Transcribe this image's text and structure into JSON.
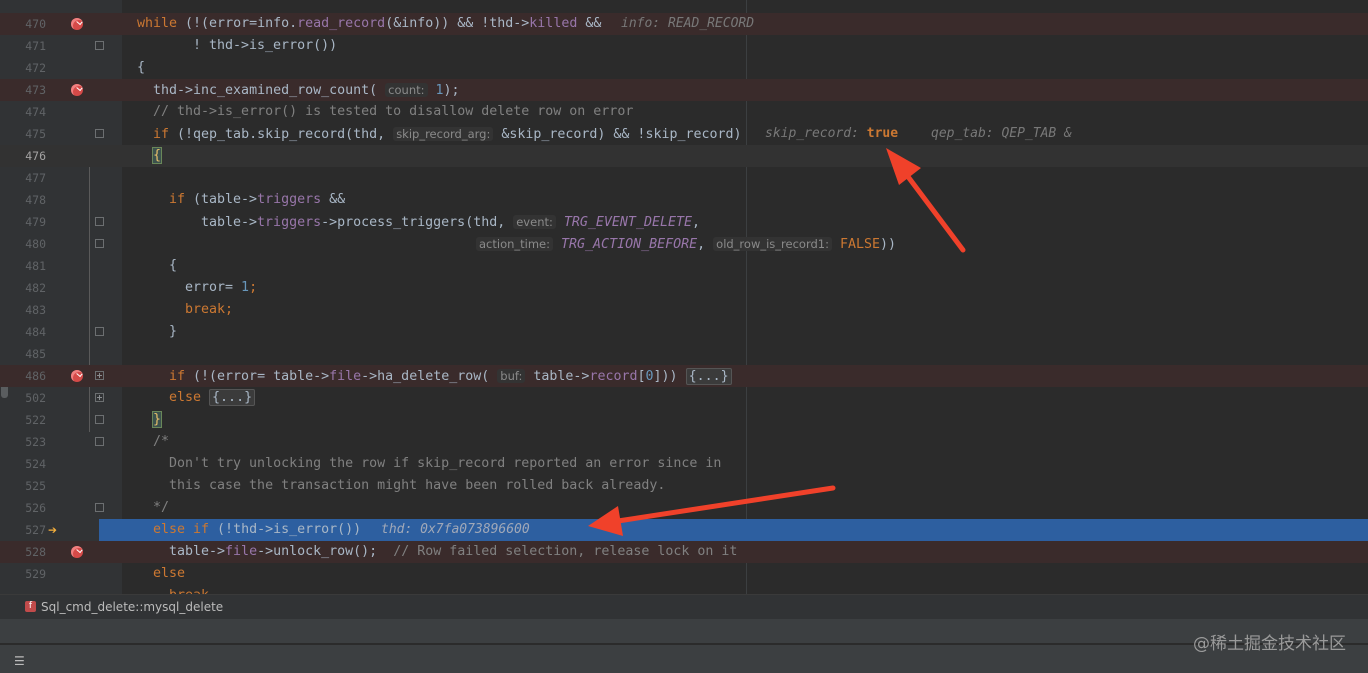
{
  "lines": [
    {
      "num": "470",
      "bp": true
    },
    {
      "num": "471"
    },
    {
      "num": "472"
    },
    {
      "num": "473",
      "bp": true
    },
    {
      "num": "474"
    },
    {
      "num": "475"
    },
    {
      "num": "476",
      "active": true
    },
    {
      "num": "477"
    },
    {
      "num": "478"
    },
    {
      "num": "479"
    },
    {
      "num": "480"
    },
    {
      "num": "481"
    },
    {
      "num": "482"
    },
    {
      "num": "483"
    },
    {
      "num": "484"
    },
    {
      "num": "485"
    },
    {
      "num": "486",
      "bp": true
    },
    {
      "num": "502"
    },
    {
      "num": "522"
    },
    {
      "num": "523"
    },
    {
      "num": "524"
    },
    {
      "num": "525"
    },
    {
      "num": "526"
    },
    {
      "num": "527",
      "exec": true
    },
    {
      "num": "528",
      "bp": true
    },
    {
      "num": "529"
    }
  ],
  "code": {
    "l470_while": "while",
    "l470_a": " (!(error=info.",
    "l470_fn": "read_record",
    "l470_b": "(&info)) && !thd->",
    "l470_fld": "killed",
    "l470_c": " &&",
    "l470_inline": "info: READ_RECORD",
    "l471": "! thd->is_error())",
    "l472": "{",
    "l473_a": "thd->inc_examined_row_count(",
    "l473_hint": "count:",
    "l473_num": "1",
    "l473_b": ");",
    "l474": "// thd->is_error() is tested to disallow delete row on error",
    "l475_if": "if",
    "l475_a": " (!qep_tab.skip_record(thd,",
    "l475_hint": "skip_record_arg:",
    "l475_b": "&skip_record) && !skip_record)",
    "l475_inline1": "skip_record: ",
    "l475_inline1_val": "true",
    "l475_inline2": "qep_tab: QEP_TAB &",
    "l476": "{",
    "l478_if": "if",
    "l478_a": " (table->",
    "l478_fld": "triggers",
    "l478_b": " &&",
    "l479_a": "table->",
    "l479_fld": "triggers",
    "l479_b": "->process_triggers(thd,",
    "l479_hint": "event:",
    "l479_enum": "TRG_EVENT_DELETE",
    "l479_c": ",",
    "l480_hint1": "action_time:",
    "l480_enum": "TRG_ACTION_BEFORE",
    "l480_c": ",",
    "l480_hint2": "old_row_is_record1:",
    "l480_false": "FALSE",
    "l480_d": "))",
    "l481": "{",
    "l482_a": "error= ",
    "l482_num": "1",
    "l482_b": ";",
    "l483_kw": "break",
    "l483_b": ";",
    "l484": "}",
    "l486_if": "if",
    "l486_a": " (!(error= table->",
    "l486_fld": "file",
    "l486_b": "->ha_delete_row(",
    "l486_hint": "buf:",
    "l486_c": "table->",
    "l486_fld2": "record",
    "l486_d": "[",
    "l486_num": "0",
    "l486_e": "]))",
    "l486_fold": "{...}",
    "l502_kw": "else",
    "l502_fold": "{...}",
    "l522": "}",
    "l523": "/*",
    "l524": "Don't try unlocking the row if skip_record reported an error since in",
    "l525": "this case the transaction might have been rolled back already.",
    "l526": "*/",
    "l527_kw": "else if",
    "l527_a": " (!thd->is_error())",
    "l527_inline": "thd: 0x7fa073896600",
    "l528_a": "table->",
    "l528_fld": "file",
    "l528_b": "->unlock_row();",
    "l528_cmt": "// Row failed selection, release lock on it",
    "l529_kw": "else",
    "l530_kw": "break"
  },
  "breadcrumb": {
    "icon": "f",
    "text": "Sql_cmd_delete::mysql_delete"
  },
  "watermark": "@稀土掘金技术社区",
  "colors": {
    "background": "#2b2b2b",
    "execution_line": "#2d5fa0",
    "breakpoint": "#d64a48",
    "keyword": "#cc7832",
    "annotation_arrow": "#f0412a"
  }
}
